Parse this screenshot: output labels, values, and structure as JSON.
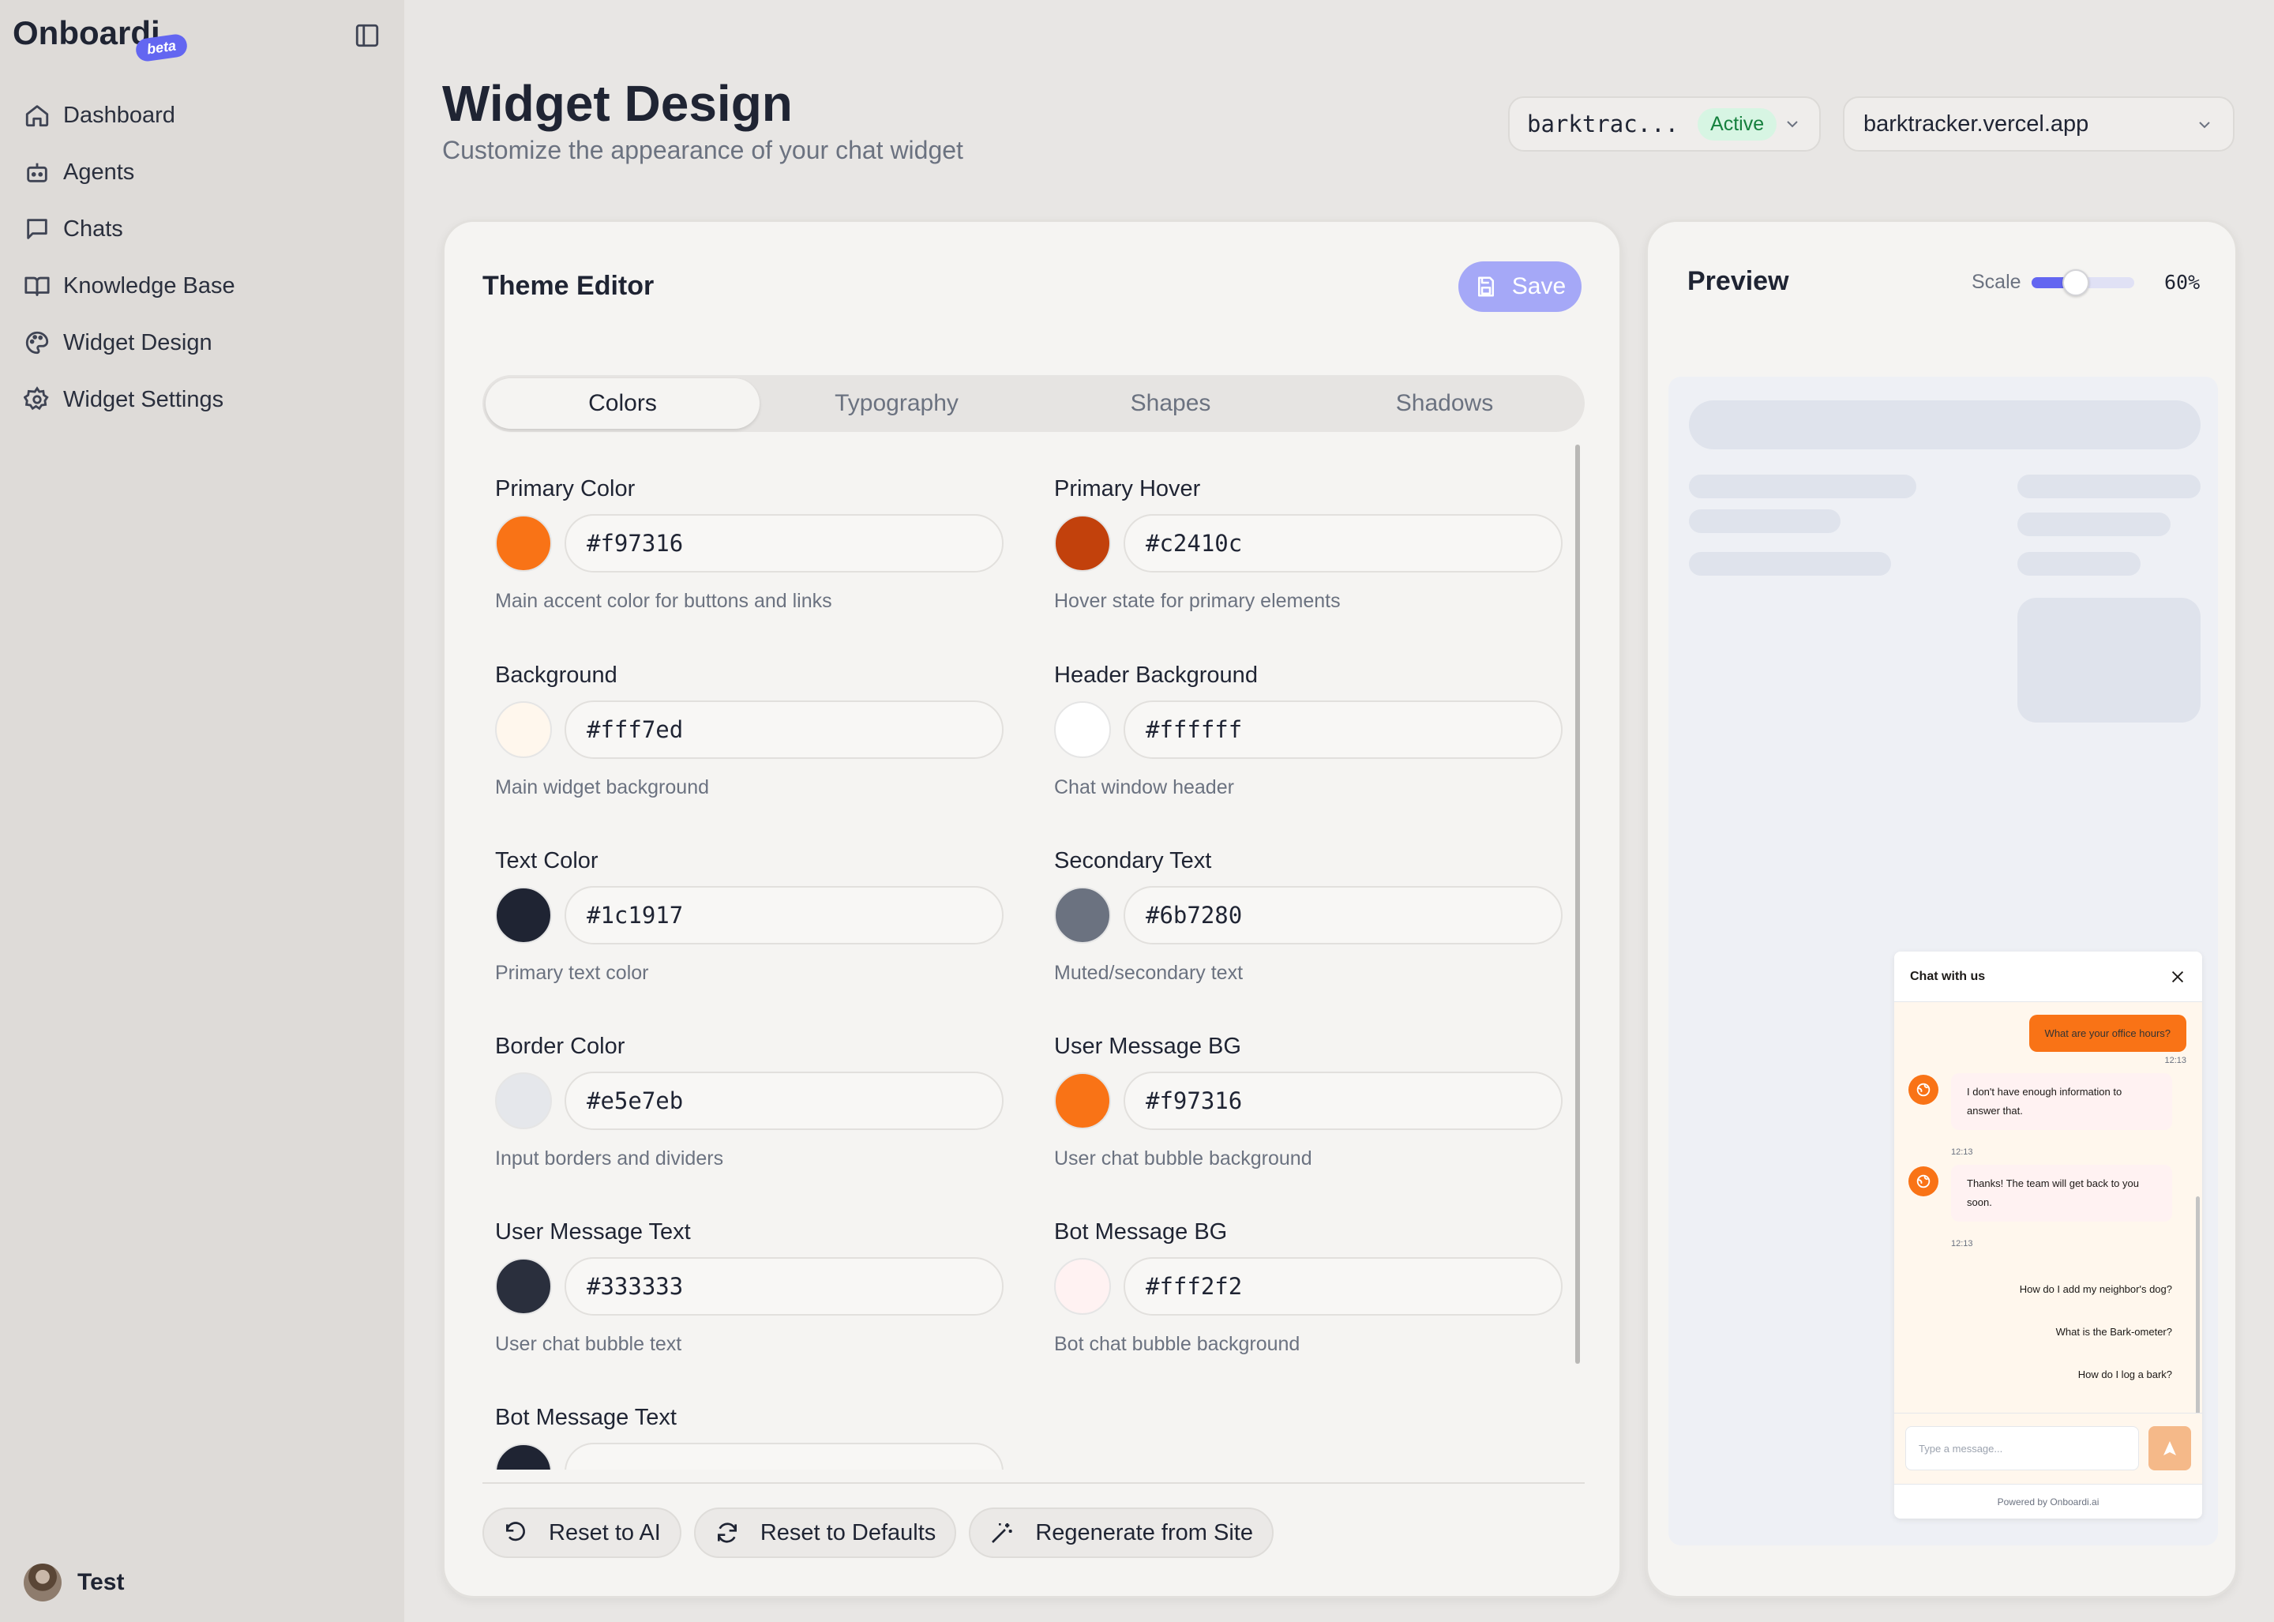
{
  "sidebar": {
    "brand": "Onboardi",
    "beta": "beta",
    "items": [
      {
        "label": "Dashboard",
        "icon": "home-icon"
      },
      {
        "label": "Agents",
        "icon": "bot-icon"
      },
      {
        "label": "Chats",
        "icon": "message-square-icon"
      },
      {
        "label": "Knowledge Base",
        "icon": "book-open-icon"
      },
      {
        "label": "Widget Design",
        "icon": "palette-icon"
      },
      {
        "label": "Widget Settings",
        "icon": "gear-icon"
      }
    ],
    "user": "Test"
  },
  "header": {
    "title": "Widget Design",
    "subtitle": "Customize the appearance of your chat widget",
    "agent_select": {
      "value": "barktrac...",
      "status": "Active"
    },
    "site_select": {
      "value": "barktracker.vercel.app"
    }
  },
  "editor": {
    "title": "Theme Editor",
    "save_label": "Save",
    "tabs": [
      "Colors",
      "Typography",
      "Shapes",
      "Shadows"
    ],
    "active_tab": "Colors",
    "fields": [
      {
        "label": "Primary Color",
        "value": "#f97316",
        "help": "Main accent color for buttons and links",
        "swatch": "#f97316"
      },
      {
        "label": "Primary Hover",
        "value": "#c2410c",
        "help": "Hover state for primary elements",
        "swatch": "#c2410c"
      },
      {
        "label": "Background",
        "value": "#fff7ed",
        "help": "Main widget background",
        "swatch": "#fff7ed"
      },
      {
        "label": "Header Background",
        "value": "#ffffff",
        "help": "Chat window header",
        "swatch": "#ffffff"
      },
      {
        "label": "Text Color",
        "value": "#1c1917",
        "help": "Primary text color",
        "swatch": "#1f2433"
      },
      {
        "label": "Secondary Text",
        "value": "#6b7280",
        "help": "Muted/secondary text",
        "swatch": "#6b7280"
      },
      {
        "label": "Border Color",
        "value": "#e5e7eb",
        "help": "Input borders and dividers",
        "swatch": "#e5e7eb"
      },
      {
        "label": "User Message BG",
        "value": "#f97316",
        "help": "User chat bubble background",
        "swatch": "#f97316"
      },
      {
        "label": "User Message Text",
        "value": "#333333",
        "help": "User chat bubble text",
        "swatch": "#2a2f3d"
      },
      {
        "label": "Bot Message BG",
        "value": "#fff2f2",
        "help": "Bot chat bubble background",
        "swatch": "#fff2f2"
      },
      {
        "label": "Bot Message Text",
        "value": "",
        "help": "",
        "swatch": "#1f2433"
      }
    ],
    "actions": [
      {
        "label": "Reset to AI",
        "icon": "undo-icon"
      },
      {
        "label": "Reset to Defaults",
        "icon": "refresh-icon"
      },
      {
        "label": "Regenerate from Site",
        "icon": "magic-wand-icon"
      }
    ]
  },
  "preview": {
    "title": "Preview",
    "scale_label": "Scale",
    "scale_value": "60%",
    "scale_fraction": 0.6,
    "chat": {
      "title": "Chat with us",
      "user_message": "What are your office hours?",
      "user_time": "12:13",
      "bot_messages": [
        {
          "text": "I don't have enough information to answer that.",
          "time": "12:13"
        },
        {
          "text": "Thanks! The team will get back to you soon.",
          "time": "12:13"
        }
      ],
      "suggestions": [
        "How do I add my neighbor's dog?",
        "What is the Bark-ometer?",
        "How do I log a bark?"
      ],
      "input_placeholder": "Type a message...",
      "powered_by": "Powered by Onboardi.ai"
    }
  },
  "colors": {
    "accent": "#6366f1",
    "primary": "#f97316",
    "active_badge_bg": "#d7f5e3",
    "active_badge_text": "#15803d"
  }
}
